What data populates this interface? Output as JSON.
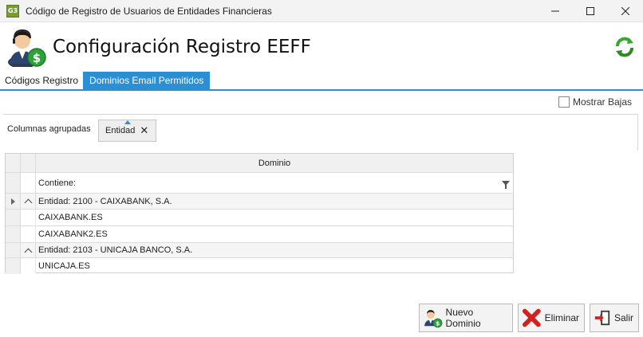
{
  "window": {
    "app_icon_text": "G3",
    "title": "Código de Registro de Usuarios de Entidades Financieras"
  },
  "header": {
    "title": "Configuración Registro EEFF"
  },
  "tabs": [
    {
      "label": "Códigos Registro",
      "active": false
    },
    {
      "label": "Dominios Email Permitidos",
      "active": true
    }
  ],
  "options": {
    "show_deleted_label": "Mostrar Bajas",
    "show_deleted_checked": false
  },
  "group_panel": {
    "label": "Columnas agrupadas",
    "chip_label": "Entidad"
  },
  "grid": {
    "column_header": "Dominio",
    "filter_text": "Contiene:",
    "rows": [
      {
        "type": "group",
        "text": "Entidad: 2100 - CAIXABANK, S.A."
      },
      {
        "type": "data",
        "text": "CAIXABANK.ES"
      },
      {
        "type": "data",
        "text": "CAIXABANK2.ES"
      },
      {
        "type": "group",
        "text": "Entidad: 2103 - UNICAJA BANCO, S.A."
      },
      {
        "type": "data",
        "text": "UNICAJA.ES"
      }
    ]
  },
  "buttons": {
    "new_label": "Nuevo Dominio",
    "delete_label": "Eliminar",
    "exit_label": "Salir"
  },
  "colors": {
    "accent": "#2b8fd6",
    "delete_red": "#d32020",
    "refresh_green": "#3aa62e"
  },
  "icons": {
    "header": "user-money-icon",
    "refresh": "refresh-icon",
    "new": "user-money-icon",
    "delete": "red-x-icon",
    "exit": "exit-door-icon"
  }
}
